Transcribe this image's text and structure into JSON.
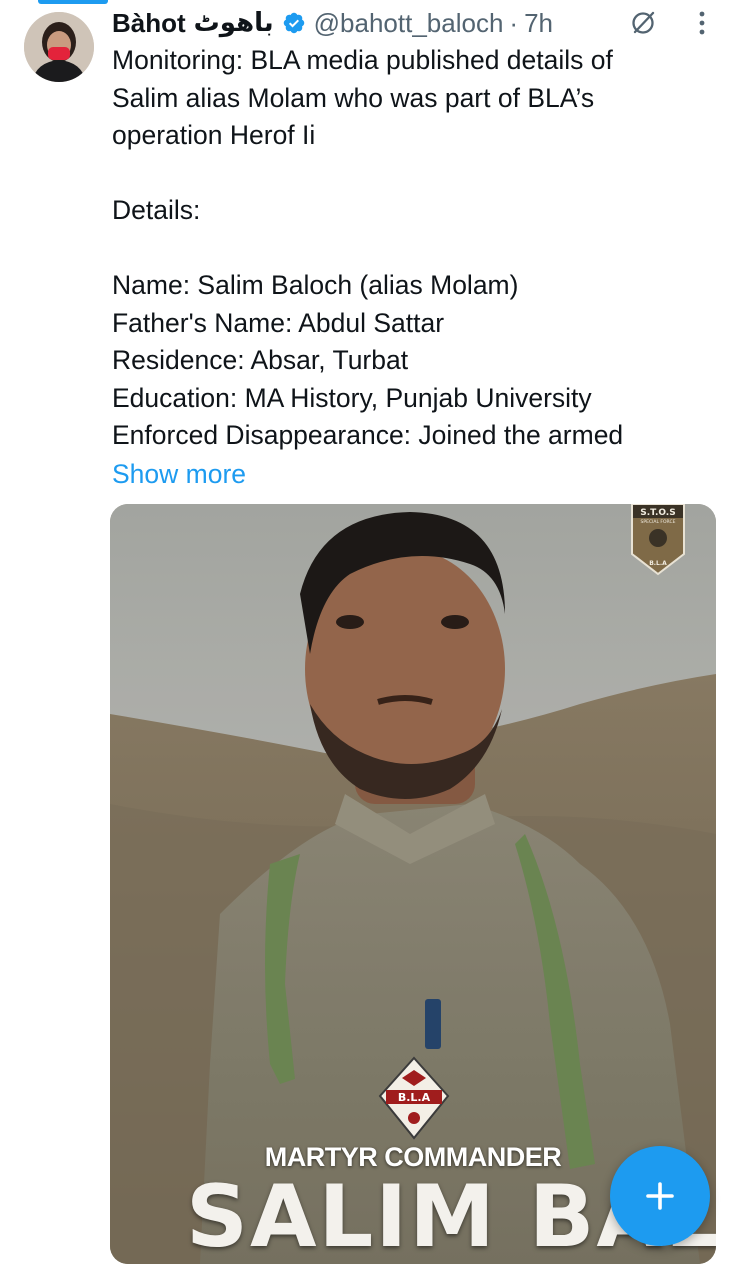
{
  "tweet": {
    "display_name": "Bàhot",
    "display_name_urdu": "باھوٹ",
    "handle": "@bahott_baloch",
    "separator": "·",
    "time": "7h",
    "lines": [
      "Monitoring: BLA media published details of",
      "Salim alias Molam who was part of BLA’s",
      "operation Herof Ii",
      "",
      "Details:",
      "",
      "Name: Salim Baloch (alias Molam)",
      "Father's Name: Abdul Sattar",
      "Residence: Absar, Turbat",
      "Education: MA History, Punjab University",
      "Enforced Disappearance: Joined the armed"
    ],
    "show_more": "Show more"
  },
  "media": {
    "badge_title": "S.T.O.S",
    "badge_subtitle": "SPECIAL FORCE",
    "badge_bottom": "B.L.A",
    "logo_text": "B.L.A",
    "caption_small": "MARTYR COMMANDER",
    "caption_big": "SALIM BALOCH"
  },
  "icons": {
    "verified": "verified-badge-icon",
    "grok": "grok-icon",
    "more": "more-vertical-icon",
    "compose": "plus-icon"
  },
  "colors": {
    "accent": "#1d9bf0",
    "text": "#0f1419",
    "secondary": "#536471"
  }
}
